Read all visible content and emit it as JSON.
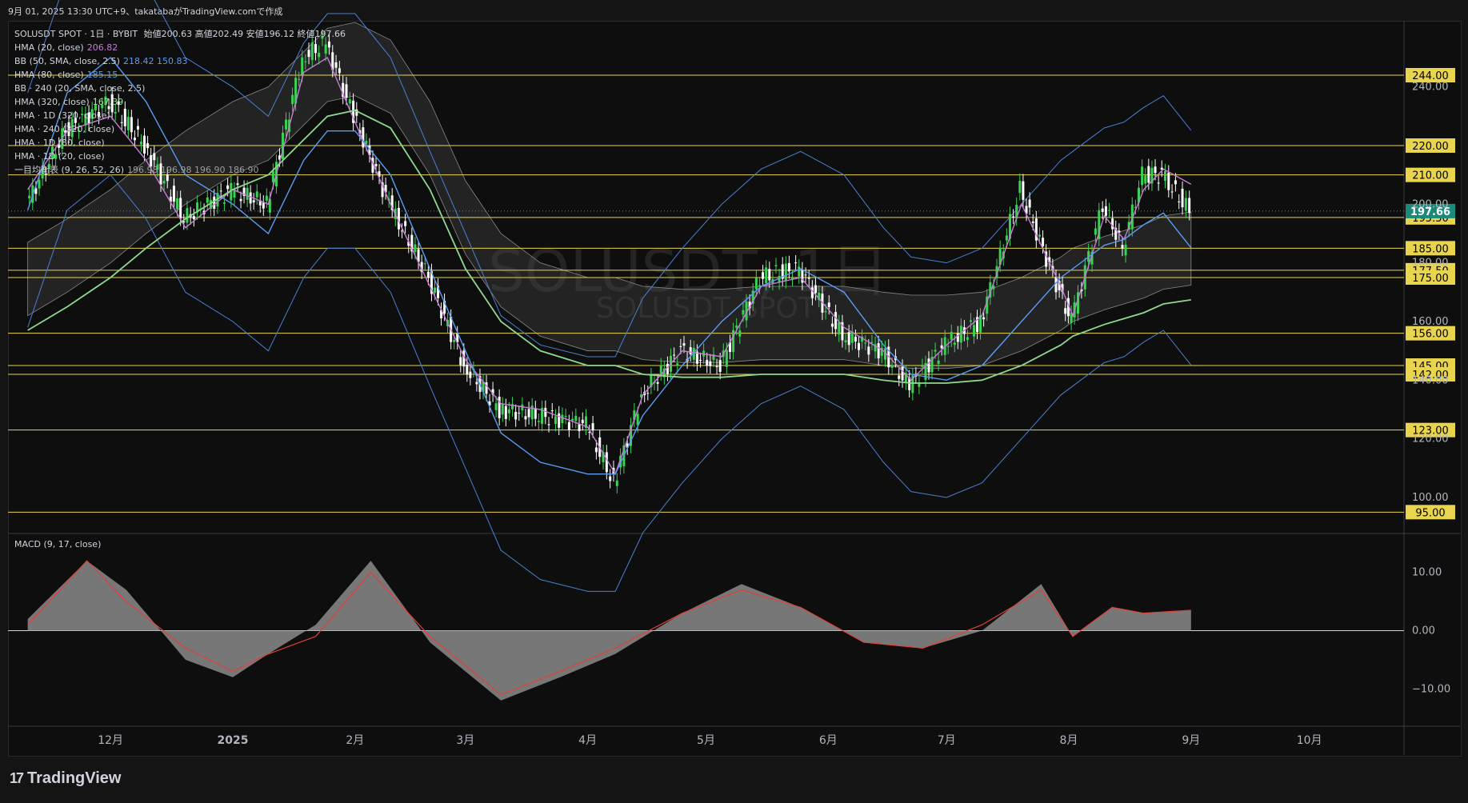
{
  "header": {
    "timestamp_line": "9月 01, 2025 13:30 UTC+9、takatabaがTradingView.comで作成"
  },
  "legend": {
    "symbol": "SOLUSDT SPOT · 1日 · BYBIT",
    "ohlc": "始値200.63 高値202.49 安値196.12 終値197.66",
    "lines": [
      {
        "label": "HMA (20, close)",
        "value": "206.82",
        "color": "#c77dd6"
      },
      {
        "label": "BB (50, SMA, close, 2.5)",
        "value": "218.42  150.83",
        "color": "#5b9cf0"
      },
      {
        "label": "HMA (80, close)",
        "value": "185.15",
        "color": "#5b9cf0"
      },
      {
        "label": "BB · 240 (20, SMA, close, 2.5)",
        "value": "",
        "color": "#d1d4dc"
      },
      {
        "label": "HMA (320, close)",
        "value": "167.39",
        "color": "#9be39b"
      },
      {
        "label": "HMA · 1D (320, close)",
        "value": "",
        "color": "#d1d4dc"
      },
      {
        "label": "HMA · 240 (320, close)",
        "value": "",
        "color": "#d1d4dc"
      },
      {
        "label": "HMA · 1D (80, close)",
        "value": "",
        "color": "#d1d4dc"
      },
      {
        "label": "HMA · 1D (20, close)",
        "value": "",
        "color": "#d1d4dc"
      },
      {
        "label": "一目均衡表 (9, 26, 52, 26)",
        "value": "196.98  196.98  196.90  186.90",
        "color": "#9e9e9e"
      }
    ]
  },
  "watermark": {
    "main": "SOLUSDT, 1日",
    "sub": "SOLUSDT SPOT"
  },
  "macd_label": "MACD (9, 17, close)",
  "price_axis": {
    "ticks": [
      "240.00",
      "200.00",
      "180.00",
      "160.00",
      "140.00",
      "120.00",
      "100.00"
    ],
    "levels": [
      {
        "label": "244.00",
        "value": 244.0
      },
      {
        "label": "220.00",
        "value": 220.0
      },
      {
        "label": "210.00",
        "value": 210.0
      },
      {
        "label": "195.50",
        "value": 195.5
      },
      {
        "label": "185.00",
        "value": 185.0
      },
      {
        "label": "177.50",
        "value": 177.5
      },
      {
        "label": "175.00",
        "value": 175.0
      },
      {
        "label": "156.00",
        "value": 156.0
      },
      {
        "label": "145.00",
        "value": 145.0
      },
      {
        "label": "142.00",
        "value": 142.0
      },
      {
        "label": "123.00",
        "value": 123.0
      },
      {
        "label": "95.00",
        "value": 95.0
      }
    ],
    "current": {
      "label": "197.66",
      "value": 197.66
    }
  },
  "macd_axis": {
    "ticks": [
      {
        "label": "10.00",
        "value": 10
      },
      {
        "label": "0.00",
        "value": 0
      },
      {
        "label": "−10.00",
        "value": -10
      }
    ]
  },
  "time_axis": {
    "labels": [
      "12月",
      "2025",
      "2月",
      "3月",
      "4月",
      "5月",
      "6月",
      "7月",
      "8月",
      "9月",
      "10月"
    ]
  },
  "colors": {
    "bg": "#0e0e0e",
    "level": "#e8d44d",
    "up": "#39d353",
    "down": "#ffffff",
    "hma20": "#c77dd6",
    "bb": "#4c7fd0",
    "hma80": "#5b9cf0",
    "hma320": "#8fd88f",
    "cloud": "#4a4a4a",
    "macd_hist": "#8a8a8a",
    "macd_signal": "#e0413a"
  },
  "brand": "TradingView",
  "chart_data": {
    "type": "candlestick",
    "title": "SOLUSDT SPOT · 1日 · BYBIT",
    "ylim": [
      88,
      262
    ],
    "x": [
      "2024-11-10",
      "2024-11-20",
      "2024-12-01",
      "2024-12-10",
      "2024-12-20",
      "2025-01-01",
      "2025-01-10",
      "2025-01-19",
      "2025-01-25",
      "2025-02-01",
      "2025-02-10",
      "2025-02-20",
      "2025-03-01",
      "2025-03-10",
      "2025-03-20",
      "2025-04-01",
      "2025-04-08",
      "2025-04-15",
      "2025-04-25",
      "2025-05-05",
      "2025-05-15",
      "2025-05-25",
      "2025-06-05",
      "2025-06-15",
      "2025-06-22",
      "2025-07-01",
      "2025-07-10",
      "2025-07-20",
      "2025-07-30",
      "2025-08-02",
      "2025-08-10",
      "2025-08-15",
      "2025-08-20",
      "2025-08-25",
      "2025-09-01"
    ],
    "series": [
      {
        "name": "close",
        "values": [
          200,
          225,
          235,
          220,
          195,
          205,
          200,
          250,
          255,
          230,
          200,
          175,
          145,
          130,
          128,
          125,
          105,
          135,
          150,
          145,
          175,
          178,
          155,
          150,
          138,
          152,
          160,
          205,
          170,
          160,
          200,
          185,
          210,
          210,
          197.66
        ]
      },
      {
        "name": "HMA (20, close)",
        "values": [
          205,
          225,
          230,
          215,
          192,
          205,
          200,
          245,
          250,
          228,
          200,
          172,
          147,
          132,
          130,
          124,
          108,
          135,
          150,
          148,
          172,
          175,
          158,
          150,
          140,
          152,
          162,
          200,
          172,
          162,
          196,
          188,
          205,
          212,
          206.82
        ]
      },
      {
        "name": "HMA (80, close)",
        "values": [
          198,
          238,
          250,
          235,
          210,
          200,
          190,
          215,
          225,
          225,
          210,
          178,
          150,
          122,
          112,
          108,
          108,
          128,
          145,
          160,
          172,
          178,
          170,
          152,
          142,
          140,
          145,
          160,
          175,
          178,
          186,
          188,
          193,
          197,
          185.15
        ]
      },
      {
        "name": "HMA (320, close)",
        "values": [
          157,
          165,
          175,
          185,
          195,
          205,
          210,
          222,
          230,
          232,
          226,
          205,
          178,
          160,
          150,
          145,
          145,
          142,
          141,
          141,
          142,
          142,
          142,
          140,
          139,
          139,
          140,
          145,
          152,
          155,
          159,
          161,
          163,
          166,
          167.39
        ]
      }
    ],
    "macd": {
      "x": [
        "2024-11-10",
        "2024-11-25",
        "2024-12-05",
        "2024-12-20",
        "2025-01-01",
        "2025-01-10",
        "2025-01-22",
        "2025-02-05",
        "2025-02-20",
        "2025-03-10",
        "2025-03-25",
        "2025-04-08",
        "2025-04-25",
        "2025-05-10",
        "2025-05-25",
        "2025-06-10",
        "2025-06-25",
        "2025-07-10",
        "2025-07-25",
        "2025-08-02",
        "2025-08-12",
        "2025-08-20",
        "2025-09-01"
      ],
      "hist": [
        2,
        12,
        7,
        -5,
        -8,
        -4,
        1,
        12,
        -2,
        -12,
        -8,
        -4,
        3,
        8,
        4,
        -2,
        -3,
        0,
        8,
        -1,
        4,
        3,
        3.5
      ],
      "signal": [
        1,
        12,
        5,
        -3,
        -7,
        -4,
        -1,
        10,
        -1,
        -11,
        -7,
        -3,
        3,
        7,
        4,
        -2,
        -3,
        1,
        7,
        -1,
        4,
        3,
        3.5
      ]
    }
  }
}
